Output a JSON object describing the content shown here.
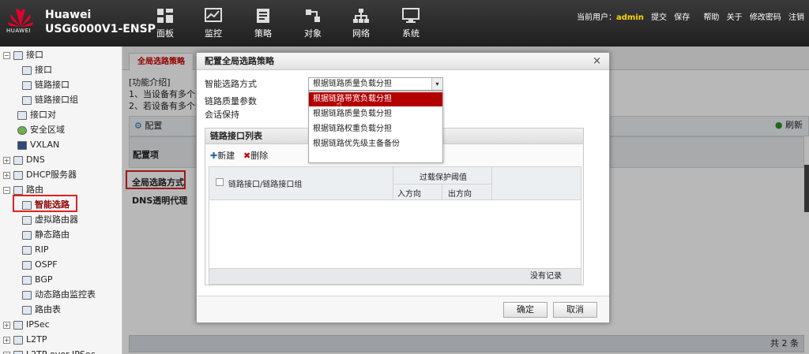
{
  "header": {
    "brand_line1": "Huawei",
    "brand_line2": "USG6000V1-ENSP",
    "logo_text": "HUAWEI",
    "nav": [
      {
        "label": "面板",
        "icon": "dashboard-icon"
      },
      {
        "label": "监控",
        "icon": "monitor-icon"
      },
      {
        "label": "策略",
        "icon": "policy-icon"
      },
      {
        "label": "对象",
        "icon": "object-icon"
      },
      {
        "label": "网络",
        "icon": "network-icon"
      },
      {
        "label": "系统",
        "icon": "system-icon"
      }
    ],
    "current_user_label": "当前用户：",
    "current_user": "admin",
    "actions": [
      "提交",
      "保存",
      "帮助",
      "关于",
      "修改密码",
      "注销"
    ]
  },
  "sidebar": {
    "items": [
      {
        "label": "接口"
      },
      {
        "label": "接口"
      },
      {
        "label": "链路接口"
      },
      {
        "label": "链路接口组"
      },
      {
        "label": "接口对"
      },
      {
        "label": "安全区域"
      },
      {
        "label": "VXLAN"
      },
      {
        "label": "DNS"
      },
      {
        "label": "DHCP服务器"
      },
      {
        "label": "路由"
      },
      {
        "label": "智能选路"
      },
      {
        "label": "虚拟路由器"
      },
      {
        "label": "静态路由"
      },
      {
        "label": "RIP"
      },
      {
        "label": "OSPF"
      },
      {
        "label": "BGP"
      },
      {
        "label": "动态路由监控表"
      },
      {
        "label": "路由表"
      },
      {
        "label": "IPSec"
      },
      {
        "label": "L2TP"
      },
      {
        "label": "L2TP over IPSec"
      }
    ]
  },
  "main": {
    "tab": "全局选路策略",
    "intro_title": "[功能介绍]",
    "intro_lines": [
      "1、当设备有多个外",
      "2、若设备有多个运"
    ],
    "config_label": "配置",
    "refresh_label": "刷新",
    "col_header": "配置项",
    "rows": [
      "全局选路方式",
      "DNS透明代理"
    ],
    "footer_count": "共 2 条"
  },
  "dialog": {
    "title": "配置全局选路策略",
    "close": "×",
    "fields": {
      "mode_label": "智能选路方式",
      "quality_label": "链路质量参数",
      "session_label": "会话保持"
    },
    "select_value": "根据链路质量负载分担",
    "options": [
      "根据链路带宽负载分担",
      "根据链路质量负载分担",
      "根据链路权重负载分担",
      "根据链路优先级主备备份"
    ],
    "selected_option_index": 0,
    "panel_title": "链路接口列表",
    "new_label": "新建",
    "delete_label": "删除",
    "grid": {
      "col_interface": "链路接口/链路接口组",
      "col_overload": "过载保护阈值",
      "col_in": "入方向",
      "col_out": "出方向"
    },
    "no_record": "没有记录",
    "ok": "确定",
    "cancel": "取消"
  },
  "colors": {
    "accent_red": "#b20000",
    "highlight_red": "#e02020",
    "user_yellow": "#ffd700"
  }
}
